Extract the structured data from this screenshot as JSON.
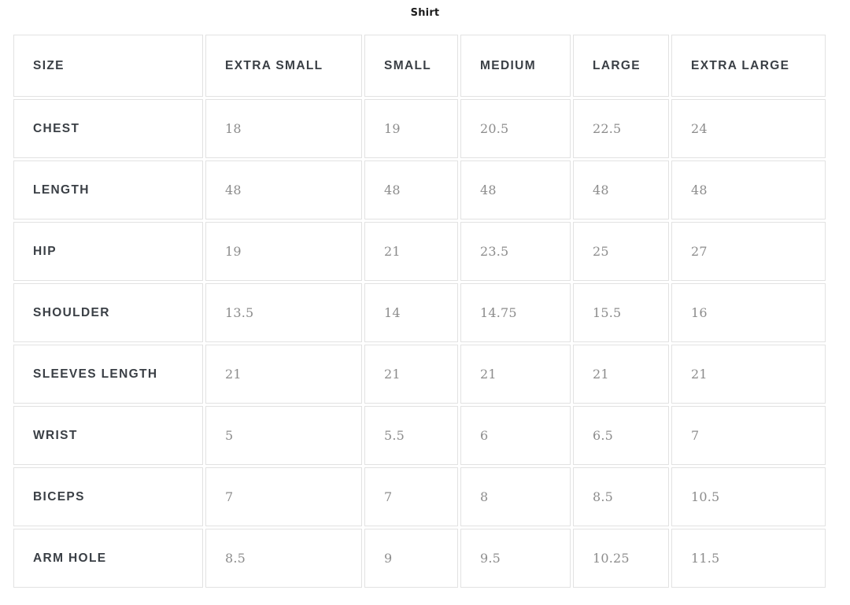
{
  "title": "Shirt",
  "table": {
    "columns": [
      "SIZE",
      "EXTRA SMALL",
      "SMALL",
      "MEDIUM",
      "LARGE",
      "EXTRA LARGE"
    ],
    "rows": [
      {
        "label": "CHEST",
        "values": [
          "18",
          "19",
          "20.5",
          "22.5",
          "24"
        ]
      },
      {
        "label": "LENGTH",
        "values": [
          "48",
          "48",
          "48",
          "48",
          "48"
        ]
      },
      {
        "label": "HIP",
        "values": [
          "19",
          "21",
          "23.5",
          "25",
          "27"
        ]
      },
      {
        "label": "SHOULDER",
        "values": [
          "13.5",
          "14",
          "14.75",
          "15.5",
          "16"
        ]
      },
      {
        "label": "SLEEVES LENGTH",
        "values": [
          "21",
          "21",
          "21",
          "21",
          "21"
        ]
      },
      {
        "label": "WRIST",
        "values": [
          "5",
          "5.5",
          "6",
          "6.5",
          "7"
        ]
      },
      {
        "label": "BICEPS",
        "values": [
          "7",
          "7",
          "8",
          "8.5",
          "10.5"
        ]
      },
      {
        "label": "ARM HOLE",
        "values": [
          "8.5",
          "9",
          "9.5",
          "10.25",
          "11.5"
        ]
      }
    ]
  },
  "chart_data": {
    "type": "table",
    "title": "Shirt",
    "categories": [
      "EXTRA SMALL",
      "SMALL",
      "MEDIUM",
      "LARGE",
      "EXTRA LARGE"
    ],
    "series": [
      {
        "name": "CHEST",
        "values": [
          18,
          19,
          20.5,
          22.5,
          24
        ]
      },
      {
        "name": "LENGTH",
        "values": [
          48,
          48,
          48,
          48,
          48
        ]
      },
      {
        "name": "HIP",
        "values": [
          19,
          21,
          23.5,
          25,
          27
        ]
      },
      {
        "name": "SHOULDER",
        "values": [
          13.5,
          14,
          14.75,
          15.5,
          16
        ]
      },
      {
        "name": "SLEEVES LENGTH",
        "values": [
          21,
          21,
          21,
          21,
          21
        ]
      },
      {
        "name": "WRIST",
        "values": [
          5,
          5.5,
          6,
          6.5,
          7
        ]
      },
      {
        "name": "BICEPS",
        "values": [
          7,
          7,
          8,
          8.5,
          10.5
        ]
      },
      {
        "name": "ARM HOLE",
        "values": [
          8.5,
          9,
          9.5,
          10.25,
          11.5
        ]
      }
    ],
    "xlabel": "SIZE",
    "ylabel": "",
    "grid": true,
    "legend": "none"
  },
  "colors": {
    "heading_text": "#3a3f45",
    "value_text": "#8c8c8c",
    "border": "#e2e2e2",
    "background": "#ffffff",
    "title_text": "#1c1c1c"
  }
}
